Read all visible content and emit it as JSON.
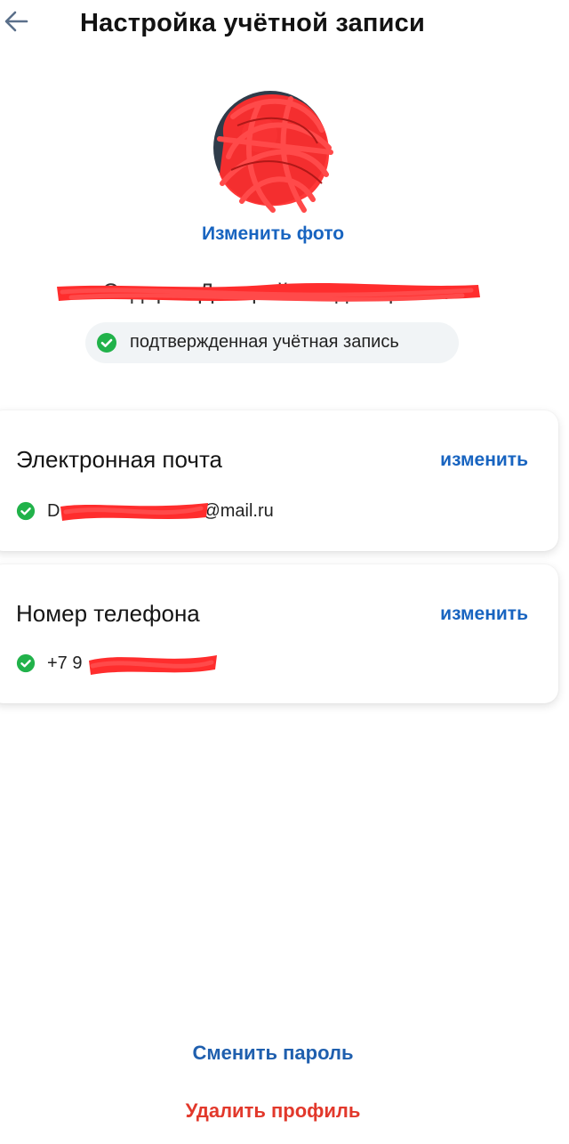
{
  "header": {
    "title": "Настройка учётной записи",
    "back_icon": "arrow-left-icon"
  },
  "profile": {
    "avatar_icon": "avatar-redacted",
    "change_photo_label": "Изменить фото",
    "name": "Сидоров Дмитрий Владимирович",
    "verified_label": "подтвержденная учётная запись"
  },
  "email_card": {
    "title": "Электронная почта",
    "edit_label": "изменить",
    "value_prefix": "D",
    "value_suffix": "@mail.ru"
  },
  "phone_card": {
    "title": "Номер телефона",
    "edit_label": "изменить",
    "value_prefix": "+7 9"
  },
  "footer": {
    "change_password_label": "Сменить пароль",
    "delete_profile_label": "Удалить профиль"
  },
  "colors": {
    "accent": "#1864c0",
    "danger": "#e2382b",
    "verified": "#21b24a",
    "redaction": "#ff2d2d"
  }
}
